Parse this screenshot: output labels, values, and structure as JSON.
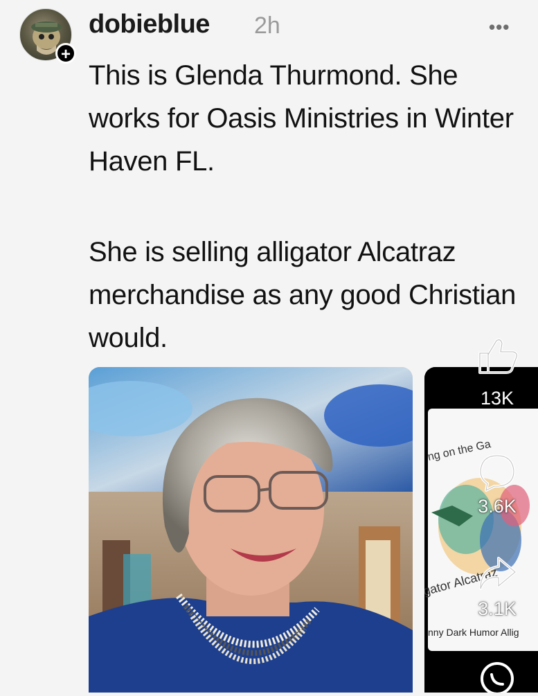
{
  "post": {
    "username": "dobieblue",
    "time": "2h",
    "more_label": "•••",
    "follow_label": "+",
    "paragraphs": [
      "This is Glenda Thurmond. She works for Oasis Ministries in Winter Haven FL.",
      "She is selling alligator Alcatraz merchandise as any good Christian would."
    ]
  },
  "media": {
    "thumbnail_caption": "nny Dark Humor Allig"
  },
  "actions": {
    "likes": "13K",
    "comments": "3.6K",
    "shares": "3.1K"
  },
  "icons": [
    "thumbs-up-icon",
    "comment-icon",
    "share-icon",
    "whatsapp-icon",
    "more-icon"
  ]
}
